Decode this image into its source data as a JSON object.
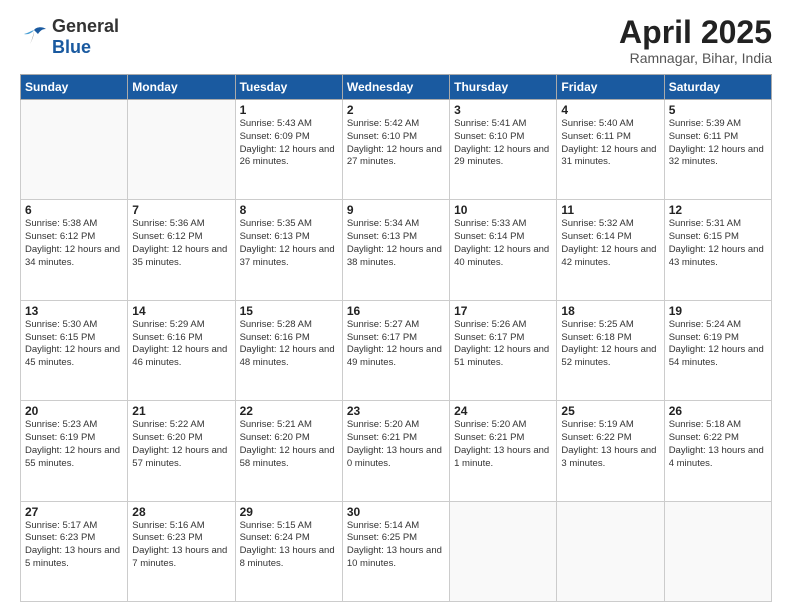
{
  "logo": {
    "general": "General",
    "blue": "Blue"
  },
  "header": {
    "month": "April 2025",
    "location": "Ramnagar, Bihar, India"
  },
  "weekdays": [
    "Sunday",
    "Monday",
    "Tuesday",
    "Wednesday",
    "Thursday",
    "Friday",
    "Saturday"
  ],
  "weeks": [
    [
      {
        "day": "",
        "info": ""
      },
      {
        "day": "",
        "info": ""
      },
      {
        "day": "1",
        "info": "Sunrise: 5:43 AM\nSunset: 6:09 PM\nDaylight: 12 hours and 26 minutes."
      },
      {
        "day": "2",
        "info": "Sunrise: 5:42 AM\nSunset: 6:10 PM\nDaylight: 12 hours and 27 minutes."
      },
      {
        "day": "3",
        "info": "Sunrise: 5:41 AM\nSunset: 6:10 PM\nDaylight: 12 hours and 29 minutes."
      },
      {
        "day": "4",
        "info": "Sunrise: 5:40 AM\nSunset: 6:11 PM\nDaylight: 12 hours and 31 minutes."
      },
      {
        "day": "5",
        "info": "Sunrise: 5:39 AM\nSunset: 6:11 PM\nDaylight: 12 hours and 32 minutes."
      }
    ],
    [
      {
        "day": "6",
        "info": "Sunrise: 5:38 AM\nSunset: 6:12 PM\nDaylight: 12 hours and 34 minutes."
      },
      {
        "day": "7",
        "info": "Sunrise: 5:36 AM\nSunset: 6:12 PM\nDaylight: 12 hours and 35 minutes."
      },
      {
        "day": "8",
        "info": "Sunrise: 5:35 AM\nSunset: 6:13 PM\nDaylight: 12 hours and 37 minutes."
      },
      {
        "day": "9",
        "info": "Sunrise: 5:34 AM\nSunset: 6:13 PM\nDaylight: 12 hours and 38 minutes."
      },
      {
        "day": "10",
        "info": "Sunrise: 5:33 AM\nSunset: 6:14 PM\nDaylight: 12 hours and 40 minutes."
      },
      {
        "day": "11",
        "info": "Sunrise: 5:32 AM\nSunset: 6:14 PM\nDaylight: 12 hours and 42 minutes."
      },
      {
        "day": "12",
        "info": "Sunrise: 5:31 AM\nSunset: 6:15 PM\nDaylight: 12 hours and 43 minutes."
      }
    ],
    [
      {
        "day": "13",
        "info": "Sunrise: 5:30 AM\nSunset: 6:15 PM\nDaylight: 12 hours and 45 minutes."
      },
      {
        "day": "14",
        "info": "Sunrise: 5:29 AM\nSunset: 6:16 PM\nDaylight: 12 hours and 46 minutes."
      },
      {
        "day": "15",
        "info": "Sunrise: 5:28 AM\nSunset: 6:16 PM\nDaylight: 12 hours and 48 minutes."
      },
      {
        "day": "16",
        "info": "Sunrise: 5:27 AM\nSunset: 6:17 PM\nDaylight: 12 hours and 49 minutes."
      },
      {
        "day": "17",
        "info": "Sunrise: 5:26 AM\nSunset: 6:17 PM\nDaylight: 12 hours and 51 minutes."
      },
      {
        "day": "18",
        "info": "Sunrise: 5:25 AM\nSunset: 6:18 PM\nDaylight: 12 hours and 52 minutes."
      },
      {
        "day": "19",
        "info": "Sunrise: 5:24 AM\nSunset: 6:19 PM\nDaylight: 12 hours and 54 minutes."
      }
    ],
    [
      {
        "day": "20",
        "info": "Sunrise: 5:23 AM\nSunset: 6:19 PM\nDaylight: 12 hours and 55 minutes."
      },
      {
        "day": "21",
        "info": "Sunrise: 5:22 AM\nSunset: 6:20 PM\nDaylight: 12 hours and 57 minutes."
      },
      {
        "day": "22",
        "info": "Sunrise: 5:21 AM\nSunset: 6:20 PM\nDaylight: 12 hours and 58 minutes."
      },
      {
        "day": "23",
        "info": "Sunrise: 5:20 AM\nSunset: 6:21 PM\nDaylight: 13 hours and 0 minutes."
      },
      {
        "day": "24",
        "info": "Sunrise: 5:20 AM\nSunset: 6:21 PM\nDaylight: 13 hours and 1 minute."
      },
      {
        "day": "25",
        "info": "Sunrise: 5:19 AM\nSunset: 6:22 PM\nDaylight: 13 hours and 3 minutes."
      },
      {
        "day": "26",
        "info": "Sunrise: 5:18 AM\nSunset: 6:22 PM\nDaylight: 13 hours and 4 minutes."
      }
    ],
    [
      {
        "day": "27",
        "info": "Sunrise: 5:17 AM\nSunset: 6:23 PM\nDaylight: 13 hours and 5 minutes."
      },
      {
        "day": "28",
        "info": "Sunrise: 5:16 AM\nSunset: 6:23 PM\nDaylight: 13 hours and 7 minutes."
      },
      {
        "day": "29",
        "info": "Sunrise: 5:15 AM\nSunset: 6:24 PM\nDaylight: 13 hours and 8 minutes."
      },
      {
        "day": "30",
        "info": "Sunrise: 5:14 AM\nSunset: 6:25 PM\nDaylight: 13 hours and 10 minutes."
      },
      {
        "day": "",
        "info": ""
      },
      {
        "day": "",
        "info": ""
      },
      {
        "day": "",
        "info": ""
      }
    ]
  ]
}
